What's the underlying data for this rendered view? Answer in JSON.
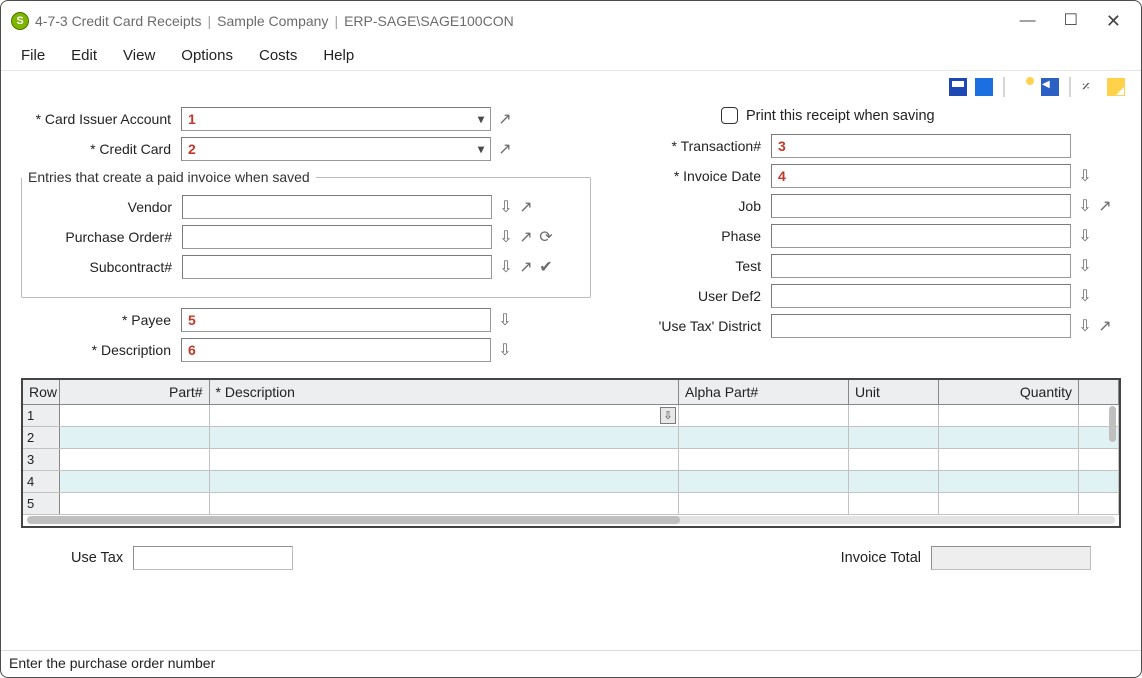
{
  "window": {
    "title_number": "4-7-3 Credit Card Receipts",
    "company": "Sample Company",
    "server": "ERP-SAGE\\SAGE100CON"
  },
  "menu": [
    "File",
    "Edit",
    "View",
    "Options",
    "Costs",
    "Help"
  ],
  "toolbar_names": [
    "icon-save",
    "icon-saveclose",
    "icon-new",
    "icon-nav",
    "icon-attach",
    "icon-note"
  ],
  "left_fields": {
    "card_issuer": {
      "label": "* Card Issuer Account",
      "value": "1"
    },
    "credit_card": {
      "label": "* Credit Card",
      "value": "2"
    },
    "payee": {
      "label": "* Payee",
      "value": "5"
    },
    "description": {
      "label": "* Description",
      "value": "6"
    }
  },
  "paid_invoice_group": {
    "legend": "Entries that create a paid invoice when saved",
    "vendor": {
      "label": "Vendor",
      "value": ""
    },
    "purchase_order": {
      "label": "Purchase Order#",
      "value": ""
    },
    "subcontract": {
      "label": "Subcontract#",
      "value": ""
    }
  },
  "right_fields": {
    "print_check": {
      "label": "Print this receipt when saving",
      "checked": false
    },
    "transaction": {
      "label": "* Transaction#",
      "value": "3"
    },
    "invoice_date": {
      "label": "* Invoice Date",
      "value": "4"
    },
    "job": {
      "label": "Job",
      "value": ""
    },
    "phase": {
      "label": "Phase",
      "value": ""
    },
    "test": {
      "label": "Test",
      "value": ""
    },
    "user_def2": {
      "label": "User Def2",
      "value": ""
    },
    "use_tax_district": {
      "label": "'Use Tax' District",
      "value": ""
    }
  },
  "grid": {
    "columns": [
      "Row",
      "Part#",
      "* Description",
      "Alpha Part#",
      "Unit",
      "Quantity"
    ],
    "rows": [
      {
        "n": "1"
      },
      {
        "n": "2"
      },
      {
        "n": "3"
      },
      {
        "n": "4"
      },
      {
        "n": "5"
      }
    ]
  },
  "totals": {
    "use_tax_label": "Use Tax",
    "invoice_total_label": "Invoice Total"
  },
  "status": "Enter the purchase order number"
}
